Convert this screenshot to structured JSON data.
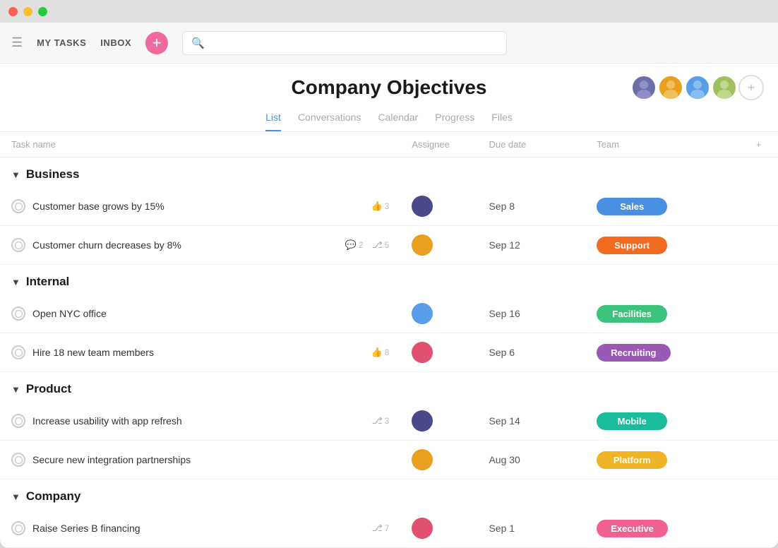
{
  "window": {
    "title": "Company Objectives"
  },
  "titlebar": {
    "close": "●",
    "min": "●",
    "max": "●"
  },
  "navbar": {
    "hamburger": "☰",
    "my_tasks_label": "MY TASKS",
    "inbox_label": "INBOX",
    "add_btn_label": "+",
    "search_placeholder": ""
  },
  "header": {
    "title": "Company Objectives",
    "avatars": [
      {
        "id": "av1",
        "initials": "",
        "color": "#6c6fa8"
      },
      {
        "id": "av2",
        "initials": "",
        "color": "#e8a020"
      },
      {
        "id": "av3",
        "initials": "",
        "color": "#5a9de8"
      },
      {
        "id": "av4",
        "initials": "",
        "color": "#a0c060"
      }
    ],
    "add_member_label": "+"
  },
  "tabs": [
    {
      "id": "list",
      "label": "List",
      "active": true
    },
    {
      "id": "conversations",
      "label": "Conversations",
      "active": false
    },
    {
      "id": "calendar",
      "label": "Calendar",
      "active": false
    },
    {
      "id": "progress",
      "label": "Progress",
      "active": false
    },
    {
      "id": "files",
      "label": "Files",
      "active": false
    }
  ],
  "table": {
    "columns": [
      {
        "id": "taskname",
        "label": "Task name"
      },
      {
        "id": "assignee",
        "label": "Assignee"
      },
      {
        "id": "duedate",
        "label": "Due date"
      },
      {
        "id": "team",
        "label": "Team"
      },
      {
        "id": "add",
        "label": "+"
      }
    ],
    "sections": [
      {
        "id": "business",
        "name": "Business",
        "rows": [
          {
            "id": "r1",
            "name": "Customer base grows by 15%",
            "meta": [
              {
                "icon": "thumbs-up",
                "count": "3"
              }
            ],
            "assignee_color": "#4a4a8a",
            "due_date": "Sep 8",
            "team_label": "Sales",
            "team_color": "#4a90e2"
          },
          {
            "id": "r2",
            "name": "Customer churn decreases by 8%",
            "meta": [
              {
                "icon": "comment",
                "count": "2"
              },
              {
                "icon": "branch",
                "count": "5"
              }
            ],
            "assignee_color": "#e8a020",
            "due_date": "Sep 12",
            "team_label": "Support",
            "team_color": "#f06a20"
          }
        ]
      },
      {
        "id": "internal",
        "name": "Internal",
        "rows": [
          {
            "id": "r3",
            "name": "Open NYC office",
            "meta": [],
            "assignee_color": "#5a9de8",
            "due_date": "Sep 16",
            "team_label": "Facilities",
            "team_color": "#3dc47c"
          },
          {
            "id": "r4",
            "name": "Hire 18 new team members",
            "meta": [
              {
                "icon": "thumbs-up",
                "count": "8"
              }
            ],
            "assignee_color": "#e05070",
            "due_date": "Sep 6",
            "team_label": "Recruiting",
            "team_color": "#9b59b6"
          }
        ]
      },
      {
        "id": "product",
        "name": "Product",
        "rows": [
          {
            "id": "r5",
            "name": "Increase usability with app refresh",
            "meta": [
              {
                "icon": "branch",
                "count": "3"
              }
            ],
            "assignee_color": "#4a4a8a",
            "due_date": "Sep 14",
            "team_label": "Mobile",
            "team_color": "#1abc9c"
          },
          {
            "id": "r6",
            "name": "Secure new integration partnerships",
            "meta": [],
            "assignee_color": "#e8a020",
            "due_date": "Aug 30",
            "team_label": "Platform",
            "team_color": "#f0b429"
          }
        ]
      },
      {
        "id": "company",
        "name": "Company",
        "rows": [
          {
            "id": "r7",
            "name": "Raise Series B financing",
            "meta": [
              {
                "icon": "branch",
                "count": "7"
              }
            ],
            "assignee_color": "#e05070",
            "due_date": "Sep 1",
            "team_label": "Executive",
            "team_color": "#f06090"
          }
        ]
      }
    ]
  },
  "icons": {
    "thumbs_up": "👍",
    "comment": "💬",
    "branch": "⎇",
    "check": "✓"
  }
}
